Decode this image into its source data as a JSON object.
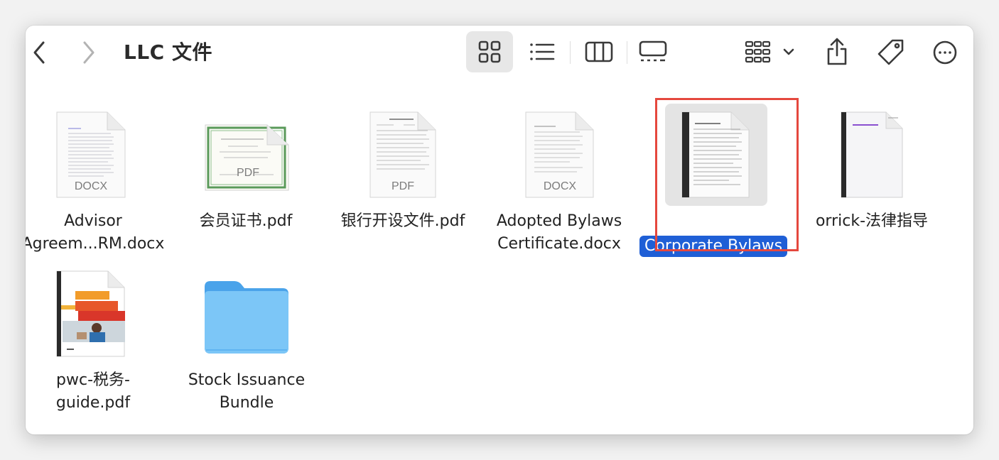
{
  "window": {
    "title": "LLC 文件"
  },
  "toolbar": {
    "back": "chevron-left-icon",
    "forward": "chevron-right-icon",
    "views": [
      "icon-view",
      "list-view",
      "column-view",
      "gallery-view"
    ],
    "active_view": "icon-view",
    "group": "group-icon",
    "share": "share-icon",
    "tags": "tag-icon",
    "more": "ellipsis-icon"
  },
  "files": [
    {
      "name": "Advisor\nAgreem...RM.docx",
      "line1": "Advisor",
      "line2": "Agreem...RM.docx",
      "kind": "docx",
      "badge": "DOCX"
    },
    {
      "name": "会员证书.pdf",
      "line1": "会员证书.pdf",
      "kind": "pdf-certificate",
      "badge": "PDF"
    },
    {
      "name": "银行开设文件.pdf",
      "line1": "银行开设文件.pdf",
      "kind": "pdf",
      "badge": "PDF"
    },
    {
      "name": "Adopted Bylaws Certificate.docx",
      "line1": "Adopted Bylaws",
      "line2": "Certificate.docx",
      "kind": "docx",
      "badge": "DOCX"
    },
    {
      "name": "Corporate Bylaws",
      "line1": "Corporate Bylaws",
      "kind": "document",
      "selected": true
    },
    {
      "name": "orrick-法律指导",
      "line1": "orrick-法律指导",
      "kind": "document"
    },
    {
      "name": "pwc-税务-guide.pdf",
      "line1": "pwc-税务-",
      "line2": "guide.pdf",
      "kind": "pdf-cover"
    },
    {
      "name": "Stock Issuance Bundle",
      "line1": "Stock Issuance",
      "line2": "Bundle",
      "kind": "folder"
    }
  ],
  "colors": {
    "selection": "#1f5fd6",
    "highlight_box": "#e5483e",
    "folder": "#5fb4f2"
  }
}
